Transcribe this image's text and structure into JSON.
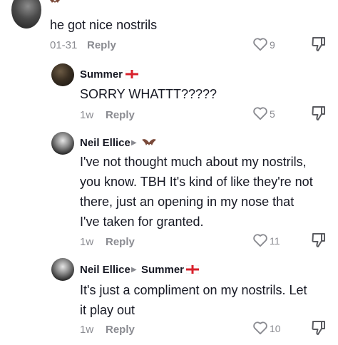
{
  "comments": [
    {
      "text": "he got nice nostrils",
      "date": "01-31",
      "reply_label": "Reply",
      "likes": "9"
    },
    {
      "author": "Summer",
      "text": "SORRY WHATTT?????",
      "date": "1w",
      "reply_label": "Reply",
      "likes": "5"
    },
    {
      "author": "Neil Ellice",
      "text_lines": [
        "I've not thought much about my nostrils,",
        "you know. TBH It's kind of like they're not",
        "there, just an opening in my nose that",
        "I've taken for granted."
      ],
      "date": "1w",
      "reply_label": "Reply",
      "likes": "11"
    },
    {
      "author": "Neil Ellice",
      "reply_to": "Summer",
      "text_lines": [
        "It's just a compliment on my nostrils. Let",
        "it play out"
      ],
      "date": "1w",
      "reply_label": "Reply",
      "likes": "10"
    }
  ],
  "icons": {
    "like": "heart-outline-icon",
    "dislike": "thumbs-down-icon",
    "flag": "england-flag-icon",
    "bat": "bat-emoji-icon",
    "arrow": "reply-arrow-icon"
  },
  "colors": {
    "text": "#161823",
    "muted": "#8a8b91",
    "flag_red": "#d8202b"
  }
}
